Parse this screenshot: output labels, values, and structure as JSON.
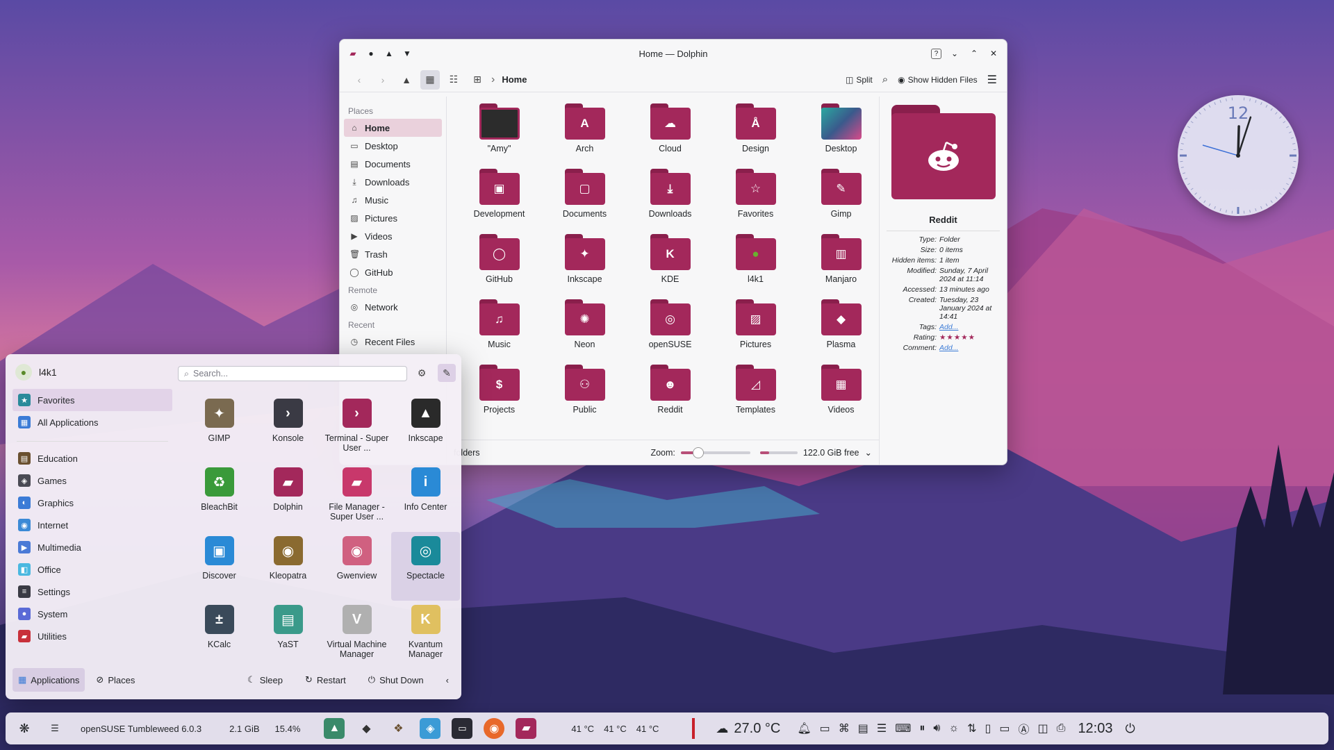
{
  "dolphin": {
    "title": "Home — Dolphin",
    "breadcrumb": "Home",
    "toolbar": {
      "split": "Split",
      "hidden": "Show Hidden Files"
    },
    "places_header": "Places",
    "places": [
      "Home",
      "Desktop",
      "Documents",
      "Downloads",
      "Music",
      "Pictures",
      "Videos",
      "Trash",
      "GitHub"
    ],
    "remote_header": "Remote",
    "remote": [
      "Network"
    ],
    "recent_header": "Recent",
    "recent": [
      "Recent Files"
    ],
    "folders": [
      "\"Amy\"",
      "Arch",
      "Cloud",
      "Design",
      "Desktop",
      "Development",
      "Documents",
      "Downloads",
      "Favorites",
      "Gimp",
      "GitHub",
      "Inkscape",
      "KDE",
      "l4k1",
      "Manjaro",
      "Music",
      "Neon",
      "openSUSE",
      "Pictures",
      "Plasma",
      "Projects",
      "Public",
      "Reddit",
      "Templates",
      "Videos"
    ],
    "status": {
      "folders": "folders",
      "zoom_label": "Zoom:",
      "zoom_level": 0.25,
      "free": "122.0 GiB free",
      "disk_used": 0.25
    },
    "info": {
      "name": "Reddit",
      "rows": [
        {
          "k": "Type:",
          "v": "Folder"
        },
        {
          "k": "Size:",
          "v": "0 items"
        },
        {
          "k": "Hidden items:",
          "v": "1 item"
        },
        {
          "k": "Modified:",
          "v": "Sunday, 7 April 2024 at 11:14"
        },
        {
          "k": "Accessed:",
          "v": "13 minutes ago"
        },
        {
          "k": "Created:",
          "v": "Tuesday, 23 January 2024 at 14:41"
        },
        {
          "k": "Tags:",
          "v": "Add..."
        },
        {
          "k": "Rating:",
          "v": "★★★★★"
        },
        {
          "k": "Comment:",
          "v": "Add..."
        }
      ]
    }
  },
  "launcher": {
    "user": "l4k1",
    "search_placeholder": "Search...",
    "categories": [
      "Favorites",
      "All Applications",
      "Education",
      "Games",
      "Graphics",
      "Internet",
      "Multimedia",
      "Office",
      "Settings",
      "System",
      "Utilities"
    ],
    "apps": [
      "GIMP",
      "Konsole",
      "Terminal - Super User ...",
      "Inkscape",
      "BleachBit",
      "Dolphin",
      "File Manager - Super User ...",
      "Info Center",
      "Discover",
      "Kleopatra",
      "Gwenview",
      "Spectacle",
      "KCalc",
      "YaST",
      "Virtual Machine Manager",
      "Kvantum Manager"
    ],
    "bottom": {
      "applications": "Applications",
      "places": "Places",
      "sleep": "Sleep",
      "restart": "Restart",
      "shutdown": "Shut Down"
    }
  },
  "clock": {
    "hour": 12,
    "minute": 3,
    "number": "12"
  },
  "taskbar": {
    "distro": "openSUSE Tumbleweed 6.0.3",
    "mem": "2.1 GiB",
    "cpu": "15.4%",
    "temps": [
      "41 °C",
      "41 °C",
      "41 °C"
    ],
    "weather": "27.0 °C",
    "time": "12:03"
  }
}
